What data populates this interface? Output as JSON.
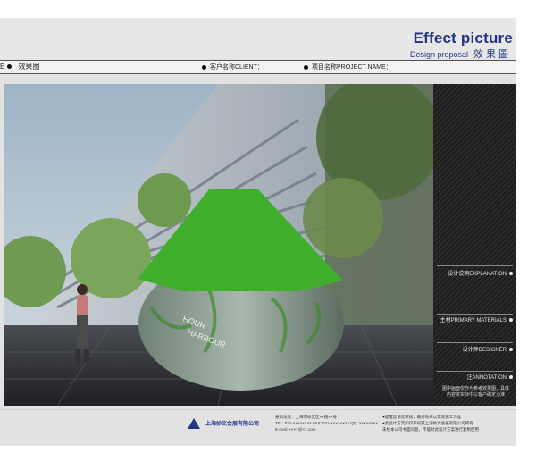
{
  "header": {
    "title": "Effect picture",
    "subtitle_en": "Design proposal",
    "subtitle_cn": "效果圖"
  },
  "infobar": {
    "section_marker": "E",
    "section_label": "效果图",
    "client_label": "客户名称CLIENT：",
    "project_label": "项目名称PROJECT NAME："
  },
  "side_panel": {
    "explanation": "设计说明EXPLANATION",
    "materials": "主材PRIMARY MATERIALS",
    "designer": "设计师DESIGNER",
    "annotation": "注ANNOTATION",
    "annotation_note": "图中画面仅作为参考效果图，具体内容依实际中以客户确定为准"
  },
  "footer": {
    "company": "上海妙文会展有限公司",
    "contact_lines": [
      "通讯地址：上海市徐汇区××路××号",
      "TEL: 021-××××××××   FAX: 021-××××××××   QQ: ××××××××",
      "E-mail: ××××@××.com"
    ],
    "notes_lines": [
      "●提醒您请您审核，最终效果以实际施工为准",
      "●此设计方案知识产权属上海妙文会展有限公司所有",
      "未经本公司书面同意，不能对此设计方案进行复制使用"
    ]
  },
  "colors": {
    "brand_blue": "#23368a",
    "canopy_green": "#3fae2a",
    "panel_dark": "#242424"
  }
}
